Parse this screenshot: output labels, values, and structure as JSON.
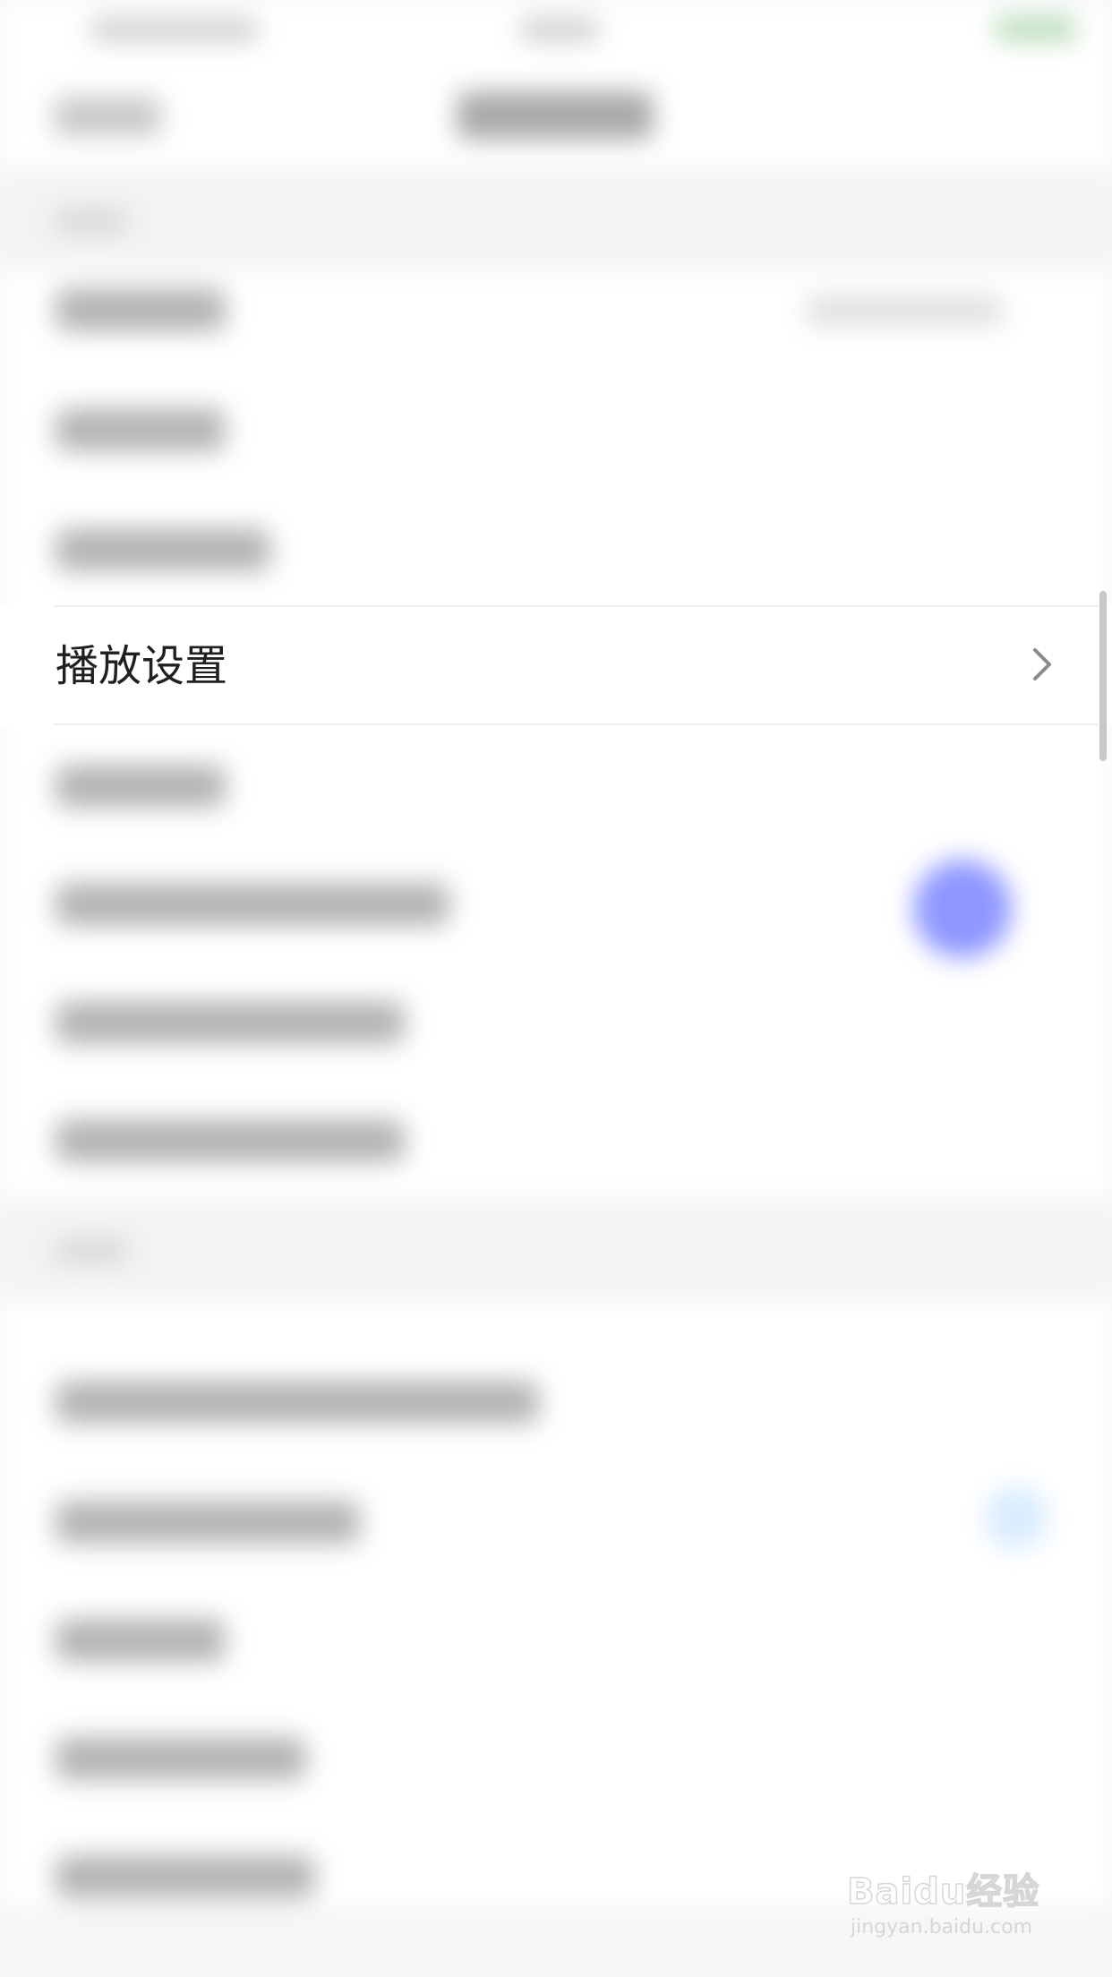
{
  "settings": {
    "playback_row": {
      "label": "播放设置"
    }
  },
  "watermark": {
    "logo_text": "Baidu经验",
    "url_text": "jingyan.baidu.com"
  },
  "colors": {
    "toggle_accent": "#8e97ff",
    "background": "#f5f6f8",
    "row_background": "#ffffff"
  },
  "icons": {
    "row_chevron": "chevron-right-icon"
  }
}
